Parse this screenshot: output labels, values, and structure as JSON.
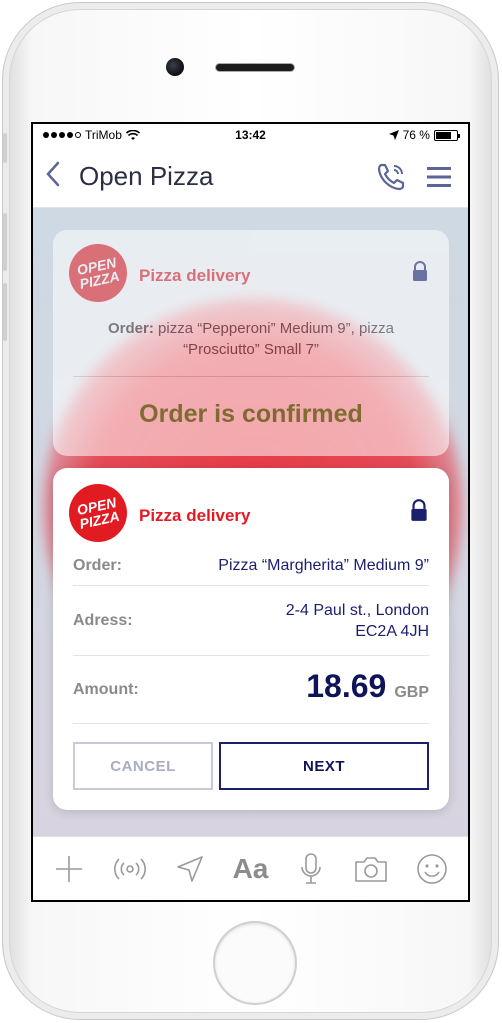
{
  "status_bar": {
    "carrier": "TriMob",
    "time": "13:42",
    "battery_percent": "76 %"
  },
  "nav": {
    "title": "Open Pizza"
  },
  "logo": {
    "line1": "OPEN",
    "line2": "PIZZA"
  },
  "previous_card": {
    "title": "Pizza delivery",
    "order_label": "Order:",
    "order_text": " pizza “Pepperoni” Medium 9”, pizza “Prosciutto” Small 7”",
    "status": "Order is confirmed"
  },
  "current_card": {
    "title": "Pizza delivery",
    "order_label": "Order:",
    "order_value": "Pizza “Margherita” Medium 9”",
    "address_label": "Adress:",
    "address_line1": "2-4 Paul st., London",
    "address_line2": "EC2A 4JH",
    "amount_label": "Amount:",
    "amount_value": "18.69",
    "amount_currency": "GBP",
    "cancel_label": "CANCEL",
    "next_label": "NEXT"
  },
  "toolbar": {
    "text_tool_label": "Aa"
  },
  "colors": {
    "brand_red": "#e21b22",
    "navy": "#1a1f6e",
    "confirmed_green": "#2e8a18"
  },
  "icons": [
    "back-chevron-icon",
    "phone-icon",
    "menu-icon",
    "lock-icon",
    "plus-icon",
    "broadcast-icon",
    "location-arrow-icon",
    "microphone-icon",
    "camera-icon",
    "smiley-icon"
  ]
}
